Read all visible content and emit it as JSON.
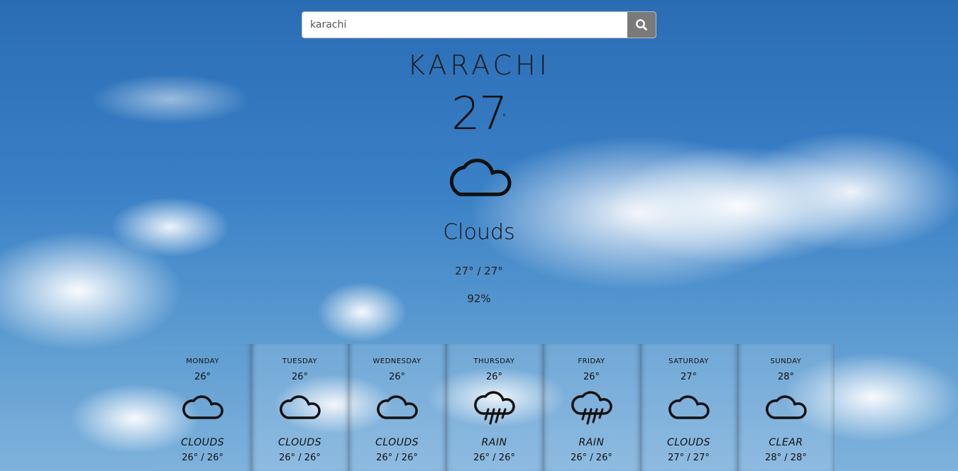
{
  "search": {
    "value": "karachi"
  },
  "current": {
    "city": "KARACHI",
    "temp": "27",
    "deg": "°",
    "icon": "cloud-icon",
    "condition": "Clouds",
    "range": "27° / 27°",
    "humidity": "92%"
  },
  "forecast": [
    {
      "day": "MONDAY",
      "temp": "26°",
      "icon": "cloud-icon",
      "condition": "CLOUDS",
      "range": "26° / 26°"
    },
    {
      "day": "TUESDAY",
      "temp": "26°",
      "icon": "cloud-icon",
      "condition": "CLOUDS",
      "range": "26° / 26°"
    },
    {
      "day": "WEDNESDAY",
      "temp": "26°",
      "icon": "cloud-icon",
      "condition": "CLOUDS",
      "range": "26° / 26°"
    },
    {
      "day": "THURSDAY",
      "temp": "26°",
      "icon": "rain-icon",
      "condition": "RAIN",
      "range": "26° / 26°"
    },
    {
      "day": "FRIDAY",
      "temp": "26°",
      "icon": "rain-icon",
      "condition": "RAIN",
      "range": "26° / 26°"
    },
    {
      "day": "SATURDAY",
      "temp": "27°",
      "icon": "cloud-icon",
      "condition": "CLOUDS",
      "range": "27° / 27°"
    },
    {
      "day": "SUNDAY",
      "temp": "28°",
      "icon": "cloud-icon",
      "condition": "CLEAR",
      "range": "28° / 28°"
    }
  ]
}
